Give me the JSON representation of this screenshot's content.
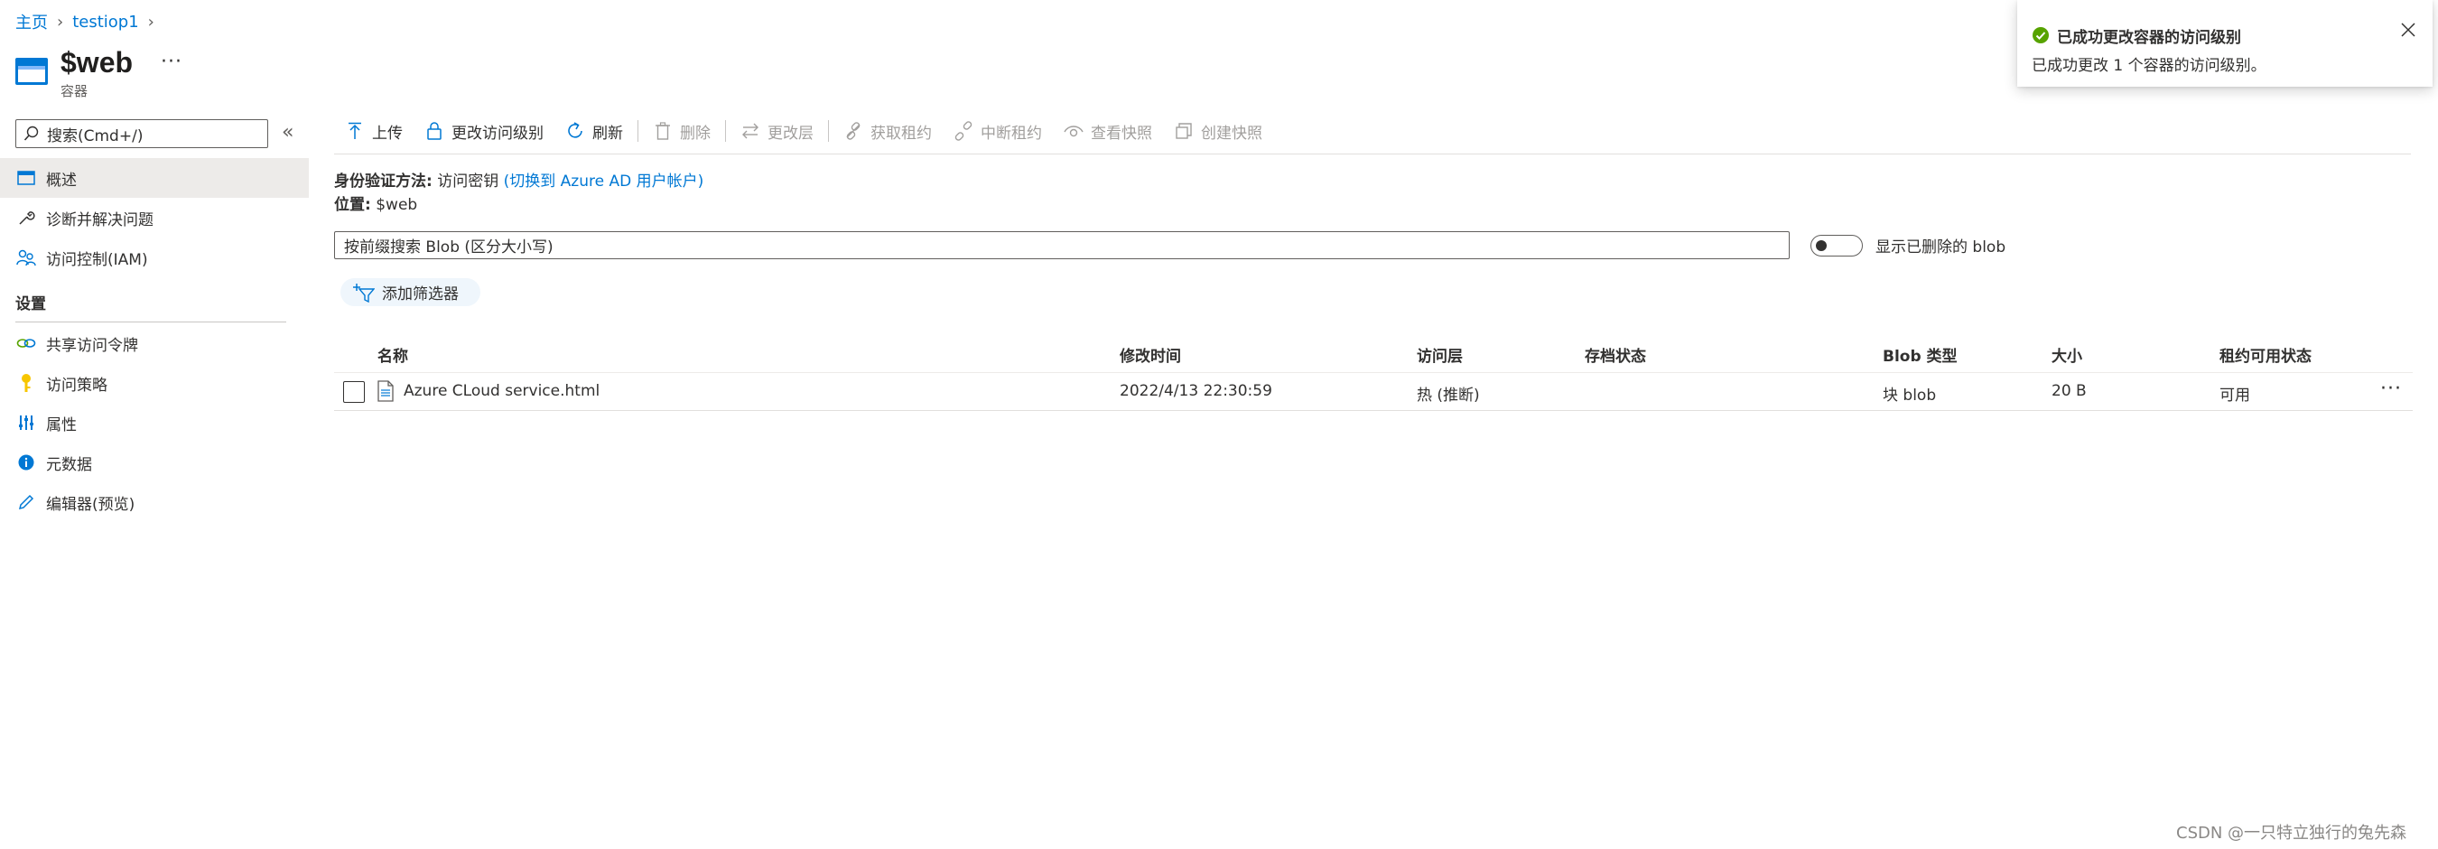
{
  "breadcrumb": {
    "home": "主页",
    "parent": "testiop1"
  },
  "header": {
    "title": "$web",
    "subtitle": "容器",
    "more": "···"
  },
  "sidebar": {
    "search_placeholder": "搜索(Cmd+/)",
    "collapse": "«",
    "items": [
      {
        "label": "概述",
        "icon": "overview-icon",
        "active": true
      },
      {
        "label": "诊断并解决问题",
        "icon": "wrench-icon"
      },
      {
        "label": "访问控制(IAM)",
        "icon": "people-icon"
      }
    ],
    "section_title": "设置",
    "settings_items": [
      {
        "label": "共享访问令牌",
        "icon": "link-icon"
      },
      {
        "label": "访问策略",
        "icon": "key-icon"
      },
      {
        "label": "属性",
        "icon": "properties-icon"
      },
      {
        "label": "元数据",
        "icon": "info-icon"
      },
      {
        "label": "编辑器(预览)",
        "icon": "pencil-icon"
      }
    ]
  },
  "toolbar": {
    "upload": "上传",
    "change_access": "更改访问级别",
    "refresh": "刷新",
    "delete": "删除",
    "change_tier": "更改层",
    "acquire_lease": "获取租约",
    "break_lease": "中断租约",
    "view_snapshots": "查看快照",
    "create_snapshot": "创建快照"
  },
  "info": {
    "auth_label": "身份验证方法:",
    "auth_value": "访问密钥",
    "auth_link": "(切换到 Azure AD 用户帐户)",
    "location_label": "位置:",
    "location_value": "$web"
  },
  "blob_search": {
    "placeholder": "按前缀搜索 Blob (区分大小写)"
  },
  "show_deleted": {
    "label": "显示已删除的 blob",
    "on": false
  },
  "add_filter": "添加筛选器",
  "table": {
    "columns": [
      "名称",
      "修改时间",
      "访问层",
      "存档状态",
      "Blob 类型",
      "大小",
      "租约可用状态"
    ],
    "rows": [
      {
        "name": "Azure CLoud service.html",
        "modified": "2022/4/13 22:30:59",
        "tier": "热 (推断)",
        "archive_status": "",
        "blob_type": "块 blob",
        "size": "20 B",
        "lease": "可用",
        "more": "···"
      }
    ]
  },
  "toast": {
    "title": "已成功更改容器的访问级别",
    "body": "已成功更改 1 个容器的访问级别。"
  },
  "watermark": "CSDN @一只特立独行的兔先森",
  "colors": {
    "accent": "#0078d4",
    "success": "#57a300",
    "text": "#323130"
  }
}
